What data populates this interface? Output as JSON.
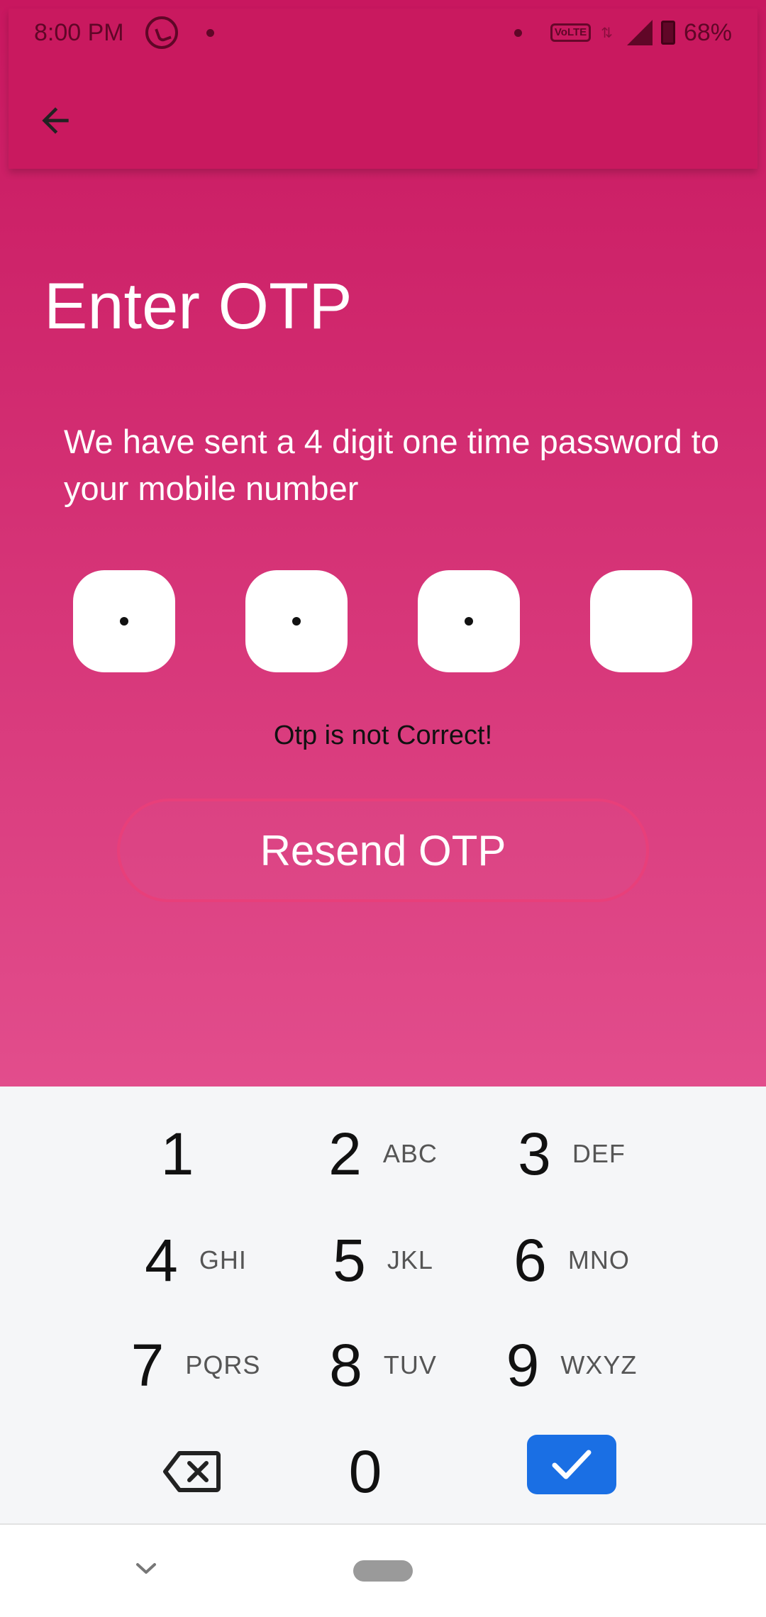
{
  "status_bar": {
    "time": "8:00 PM",
    "volte": "VoLTE",
    "battery": "68%",
    "icons": [
      "whatsapp-icon",
      "volte-icon",
      "data-arrows-icon",
      "signal-icon",
      "battery-charging-icon"
    ]
  },
  "app_bar": {
    "back_icon": "arrow-left-icon"
  },
  "page": {
    "title": "Enter OTP",
    "subtitle": "We have sent a 4 digit one time password to your mobile number",
    "otp_boxes": [
      {
        "filled": true
      },
      {
        "filled": true
      },
      {
        "filled": true
      },
      {
        "filled": false
      }
    ],
    "error_message": "Otp is not Correct!",
    "resend_label": "Resend OTP"
  },
  "keypad": {
    "keys": [
      {
        "num": "1",
        "letters": ""
      },
      {
        "num": "2",
        "letters": "ABC"
      },
      {
        "num": "3",
        "letters": "DEF"
      },
      {
        "num": "4",
        "letters": "GHI"
      },
      {
        "num": "5",
        "letters": "JKL"
      },
      {
        "num": "6",
        "letters": "MNO"
      },
      {
        "num": "7",
        "letters": "PQRS"
      },
      {
        "num": "8",
        "letters": "TUV"
      },
      {
        "num": "9",
        "letters": "WXYZ"
      },
      {
        "num": "0",
        "letters": ""
      }
    ],
    "backspace_icon": "backspace-icon",
    "done_icon": "check-icon",
    "done_color": "#1a6fe4"
  },
  "nav_bar": {
    "icons": [
      "chevron-down-icon",
      "home-pill-icon"
    ]
  },
  "colors": {
    "primary": "#c9195f",
    "gradient_end": "#e24d8c",
    "resend_border": "#e83f7a"
  }
}
